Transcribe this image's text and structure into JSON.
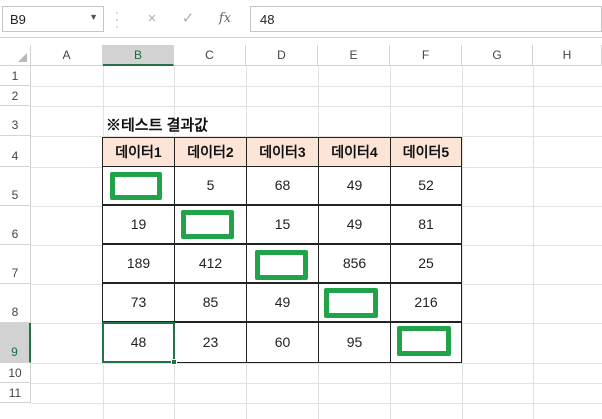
{
  "formula_bar": {
    "name_box": "B9",
    "formula": "48",
    "cancel_icon": "×",
    "enter_icon": "✓",
    "function_icon": "fx"
  },
  "columns": [
    "A",
    "B",
    "C",
    "D",
    "E",
    "F",
    "G",
    "H"
  ],
  "selected_column": "B",
  "rows": [
    "1",
    "2",
    "3",
    "4",
    "5",
    "6",
    "7",
    "8",
    "9",
    "10",
    "11"
  ],
  "selected_row": "9",
  "sheet": {
    "title": "※테스트 결과값",
    "headers": [
      "데이터1",
      "데이터2",
      "데이터3",
      "데이터4",
      "데이터5"
    ],
    "body": [
      [
        "",
        "5",
        "68",
        "49",
        "52"
      ],
      [
        "19",
        "",
        "15",
        "49",
        "81"
      ],
      [
        "189",
        "412",
        "",
        "856",
        "25"
      ],
      [
        "73",
        "85",
        "49",
        "",
        "216"
      ],
      [
        "48",
        "23",
        "60",
        "95",
        ""
      ]
    ],
    "highlight_color": "#21a34a",
    "header_fill": "#fce4d6"
  }
}
